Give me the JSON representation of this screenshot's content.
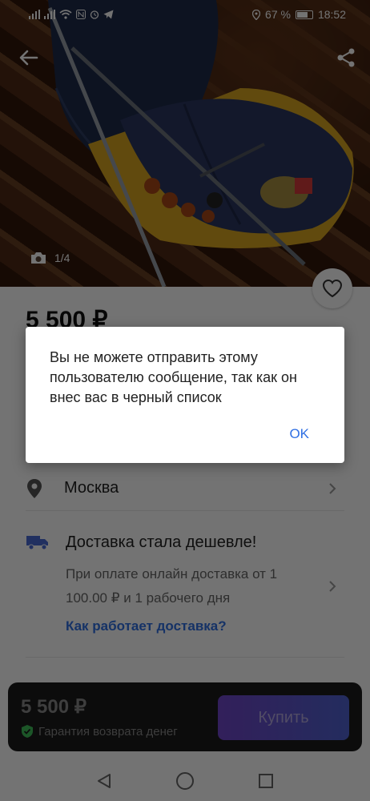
{
  "status_bar": {
    "signal_left": "ᴵᴵᴵ",
    "battery": "67 %",
    "time": "18:52"
  },
  "photo": {
    "counter": "1/4"
  },
  "listing": {
    "price": "5 500 ₽",
    "location": "Москва",
    "delivery_title": "Доставка стала дешевле!",
    "delivery_text": "При оплате онлайн доставка от 1 100.00 ₽ и 1 рабочего дня",
    "delivery_link": "Как работает доставка?"
  },
  "buy_bar": {
    "price": "5 500 ₽",
    "guarantee": "Гарантия возврата денег",
    "buy_label": "Купить"
  },
  "dialog": {
    "message": "Вы не можете отправить этому пользователю сообщение, так как он внес вас в черный список",
    "ok_label": "OK"
  },
  "colors": {
    "accent": "#2f6fe3",
    "buy_gradient_start": "#7046c9",
    "buy_gradient_end": "#4f63d1",
    "guarantee_check": "#3fbf5a"
  },
  "icons": [
    "back-arrow-icon",
    "share-icon",
    "camera-icon",
    "heart-icon",
    "location-pin-icon",
    "truck-icon",
    "chevron-right-icon",
    "shield-check-icon",
    "nav-back-icon",
    "nav-home-icon",
    "nav-recents-icon"
  ]
}
